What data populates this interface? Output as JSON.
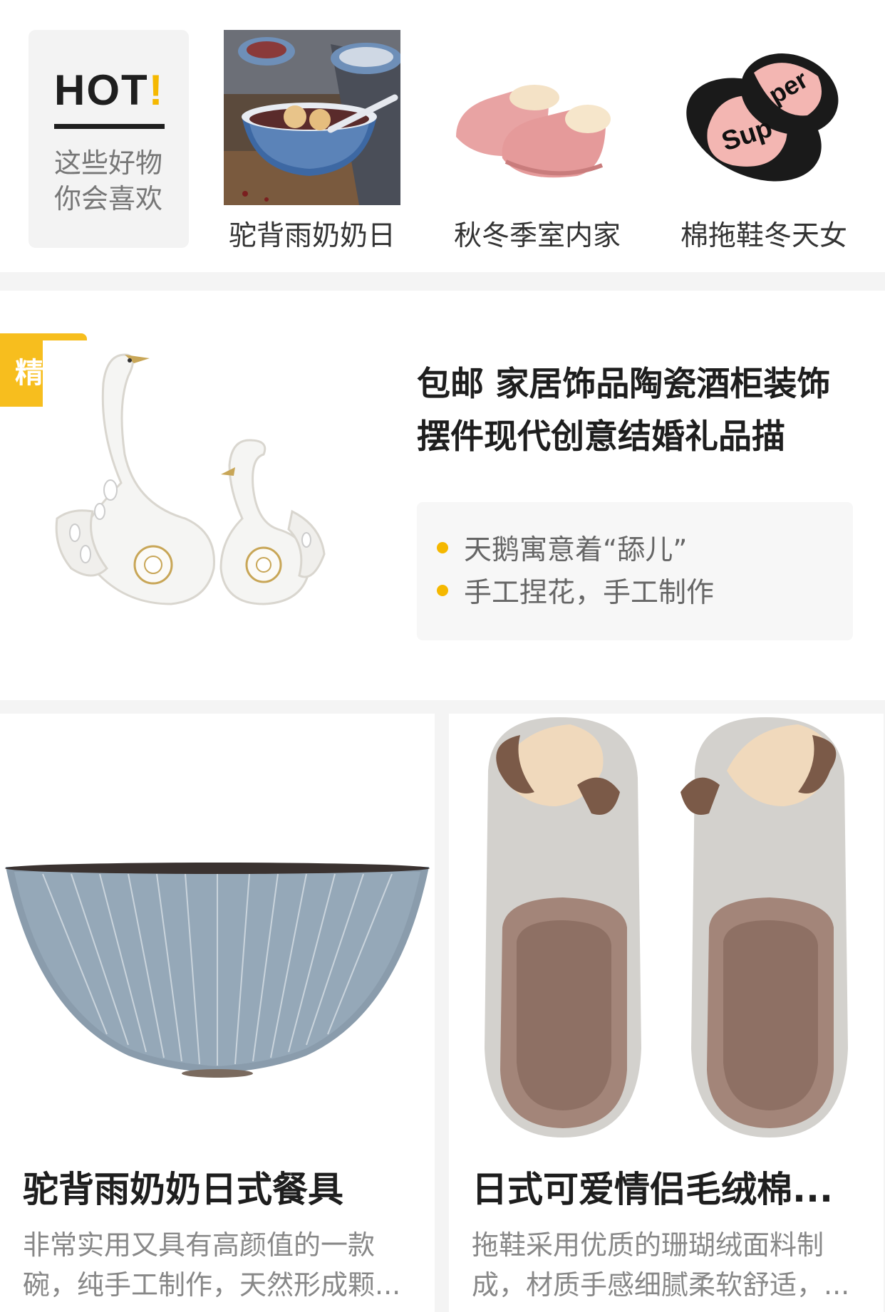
{
  "hot": {
    "title": "HOT",
    "bang": "!",
    "subtitle_line1": "这些好物",
    "subtitle_line2": "你会喜欢",
    "items": [
      {
        "label": "驼背雨奶奶日",
        "icon": "bowl-soup-image"
      },
      {
        "label": "秋冬季室内家",
        "icon": "pink-slipper-image"
      },
      {
        "label": "棉拖鞋冬天女",
        "icon": "supper-slipper-image"
      }
    ]
  },
  "featured": {
    "badge": "精选",
    "title": "包邮 家居饰品陶瓷酒柜装饰摆件现代创意结婚礼品描",
    "points": [
      "天鹅寓意着“舔儿”",
      "手工捏花，手工制作"
    ],
    "image": "white-swan-ornament-image"
  },
  "products": [
    {
      "title": "驼背雨奶奶日式餐具",
      "desc": "非常实用又具有高颜值的一款碗，纯手工制作，天然形成颗...",
      "image": "blue-ceramic-bowl-image"
    },
    {
      "title": "日式可爱情侣毛绒棉...",
      "desc": "拖鞋采用优质的珊瑚绒面料制成，材质手感细腻柔软舒适，...",
      "image": "hedgehog-slipper-image"
    }
  ],
  "colors": {
    "accent": "#f5b800",
    "badge": "#f7be1e",
    "background": "#f4f4f4"
  }
}
